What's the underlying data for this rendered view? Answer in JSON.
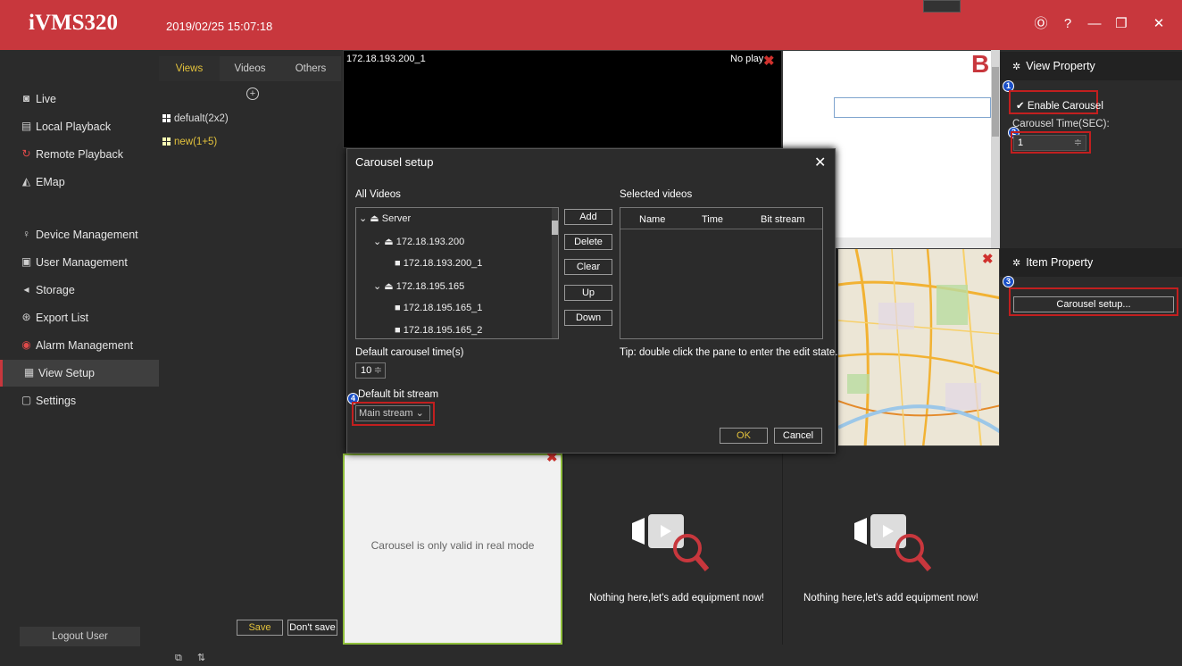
{
  "titlebar": {
    "app_name": "iVMS320",
    "datetime": "2019/02/25 15:07:18",
    "icons": [
      "info-icon",
      "help-icon",
      "minimize-icon",
      "restore-icon",
      "close-icon"
    ],
    "info_glyph": "Ⓞ",
    "help_glyph": "?",
    "minimize_glyph": "—",
    "restore_glyph": "❐",
    "close_glyph": "✕"
  },
  "sidebar": {
    "items": [
      {
        "label": "Live",
        "icon": "live-icon"
      },
      {
        "label": "Local Playback",
        "icon": "local-playback-icon"
      },
      {
        "label": "Remote Playback",
        "icon": "remote-playback-icon"
      },
      {
        "label": "EMap",
        "icon": "emap-icon"
      },
      {
        "label": "Device Management",
        "icon": "device-icon"
      },
      {
        "label": "User Management",
        "icon": "user-icon"
      },
      {
        "label": "Storage",
        "icon": "storage-icon"
      },
      {
        "label": "Export List",
        "icon": "export-icon"
      },
      {
        "label": "Alarm Management",
        "icon": "alarm-icon"
      },
      {
        "label": "View Setup",
        "icon": "view-setup-icon",
        "active": true
      },
      {
        "label": "Settings",
        "icon": "settings-icon"
      }
    ],
    "logout_label": "Logout User"
  },
  "views_panel": {
    "tabs": [
      "Views",
      "Videos",
      "Others"
    ],
    "add_glyph": "+",
    "views": [
      "defualt(2x2)",
      "new(1+5)"
    ],
    "save_label": "Save",
    "dont_save_label": "Don't save",
    "bottom_icons": [
      "copy-icon",
      "sort-icon"
    ]
  },
  "center": {
    "pane1_label": "172.18.193.200_1",
    "pane1_status": "No play",
    "white_pane_text": "Carousel is only valid in real mode",
    "empty_text": "Nothing here,let's add equipment now!",
    "web_logo": "B"
  },
  "right_panel": {
    "view_property_title": "View Property",
    "enable_carousel_label": "Enable Carousel",
    "carousel_time_label": "Carousel Time(SEC):",
    "carousel_time_value": "1",
    "item_property_title": "Item Property",
    "carousel_setup_label": "Carousel setup..."
  },
  "dialog": {
    "title": "Carousel setup",
    "all_videos_label": "All Videos",
    "selected_videos_label": "Selected videos",
    "tree": [
      {
        "label": "Server",
        "level": 0,
        "type": "server"
      },
      {
        "label": "172.18.193.200",
        "level": 1,
        "type": "device"
      },
      {
        "label": "172.18.193.200_1",
        "level": 2,
        "type": "camera"
      },
      {
        "label": "172.18.195.165",
        "level": 1,
        "type": "device"
      },
      {
        "label": "172.18.195.165_1",
        "level": 2,
        "type": "camera"
      },
      {
        "label": "172.18.195.165_2",
        "level": 2,
        "type": "camera"
      }
    ],
    "buttons": [
      "Add",
      "Delete",
      "Clear",
      "Up",
      "Down"
    ],
    "columns": [
      "Name",
      "Time",
      "Bit stream"
    ],
    "default_time_label": "Default carousel time(s)",
    "default_time_value": "10",
    "default_bitstream_label": "Default bit stream",
    "bitstream_value": "Main stream",
    "tip": "Tip: double click the pane to enter the edit state.",
    "ok_label": "OK",
    "cancel_label": "Cancel"
  },
  "annotations": [
    "1",
    "2",
    "3",
    "4"
  ],
  "colors": {
    "accent": "#c8373d",
    "active_tab": "#e3c23c",
    "highlight_box": "#c21f1f",
    "badge": "#1a4fc7",
    "selected_pane_border": "#8fbf3a"
  }
}
